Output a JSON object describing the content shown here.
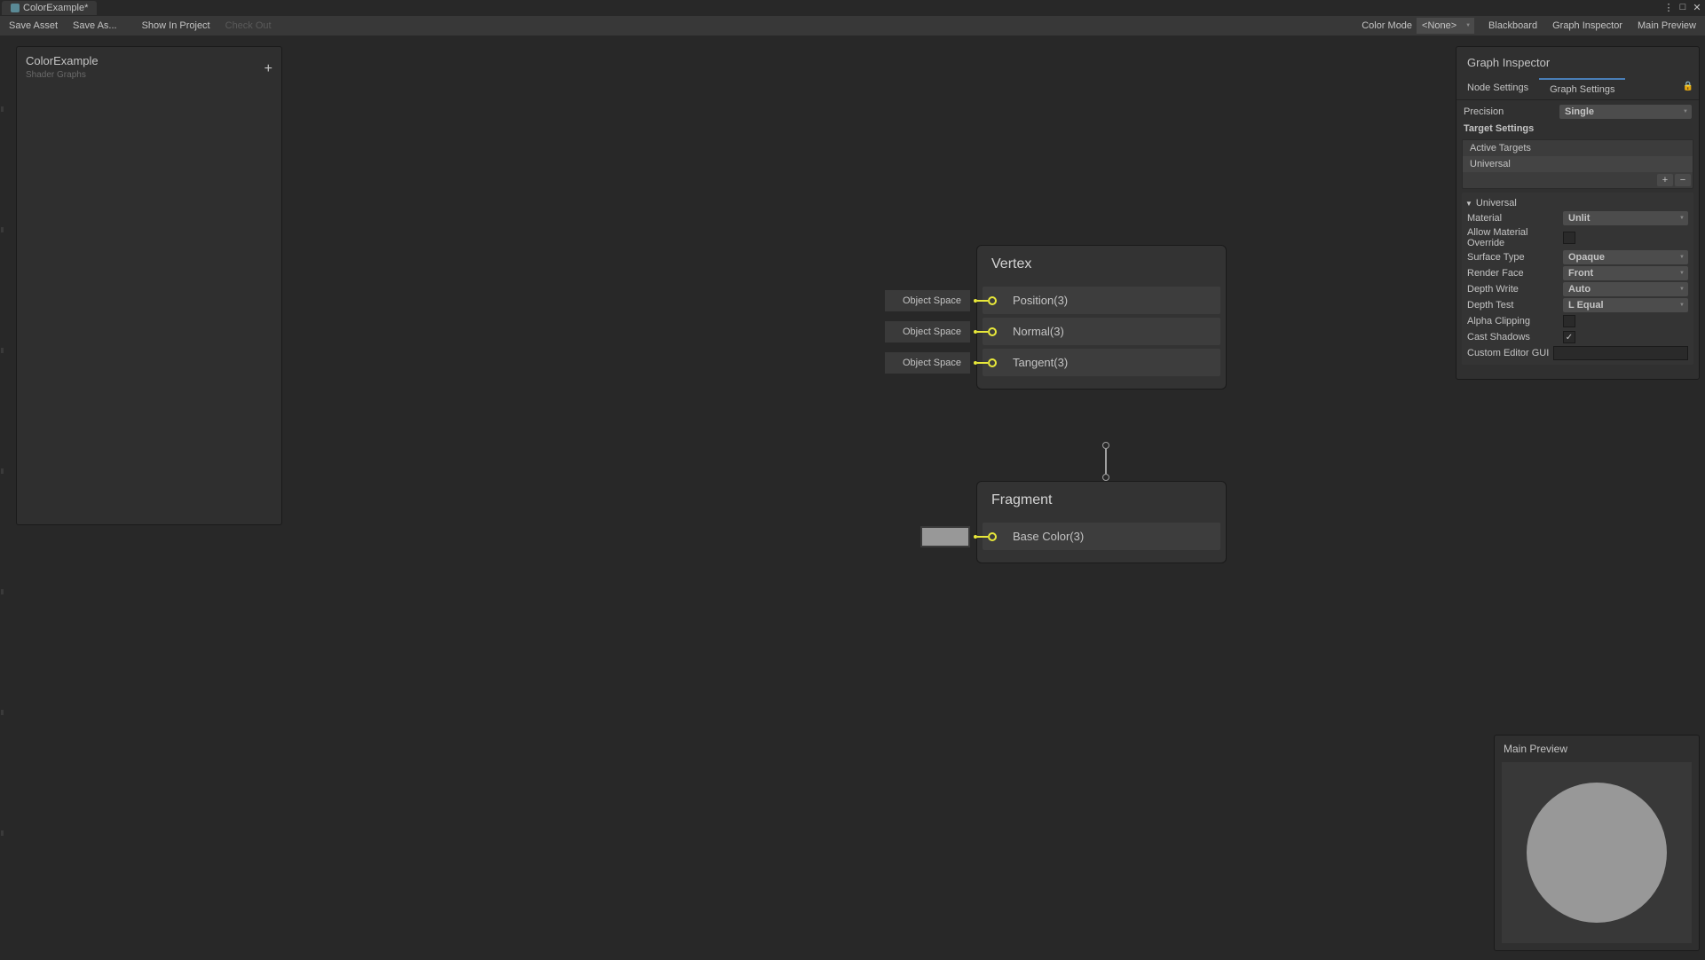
{
  "tab": {
    "title": "ColorExample*"
  },
  "toolbar": {
    "save_asset": "Save Asset",
    "save_as": "Save As...",
    "show_in_project": "Show In Project",
    "check_out": "Check Out",
    "color_mode_label": "Color Mode",
    "color_mode_value": "<None>",
    "blackboard": "Blackboard",
    "graph_inspector": "Graph Inspector",
    "main_preview": "Main Preview"
  },
  "blackboard": {
    "title": "ColorExample",
    "subtitle": "Shader Graphs"
  },
  "nodes": {
    "vertex": {
      "title": "Vertex",
      "ports": [
        {
          "input_label": "Object Space",
          "name": "Position(3)"
        },
        {
          "input_label": "Object Space",
          "name": "Normal(3)"
        },
        {
          "input_label": "Object Space",
          "name": "Tangent(3)"
        }
      ]
    },
    "fragment": {
      "title": "Fragment",
      "ports": [
        {
          "name": "Base Color(3)"
        }
      ]
    }
  },
  "inspector": {
    "title": "Graph Inspector",
    "tabs": {
      "node_settings": "Node Settings",
      "graph_settings": "Graph Settings"
    },
    "precision_label": "Precision",
    "precision_value": "Single",
    "target_settings": "Target Settings",
    "active_targets": "Active Targets",
    "target_item": "Universal",
    "universal": {
      "header": "Universal",
      "material_label": "Material",
      "material_value": "Unlit",
      "allow_override": "Allow Material Override",
      "surface_type_label": "Surface Type",
      "surface_type_value": "Opaque",
      "render_face_label": "Render Face",
      "render_face_value": "Front",
      "depth_write_label": "Depth Write",
      "depth_write_value": "Auto",
      "depth_test_label": "Depth Test",
      "depth_test_value": "L Equal",
      "alpha_clipping": "Alpha Clipping",
      "cast_shadows": "Cast Shadows",
      "custom_editor_gui": "Custom Editor GUI"
    }
  },
  "preview": {
    "title": "Main Preview"
  }
}
